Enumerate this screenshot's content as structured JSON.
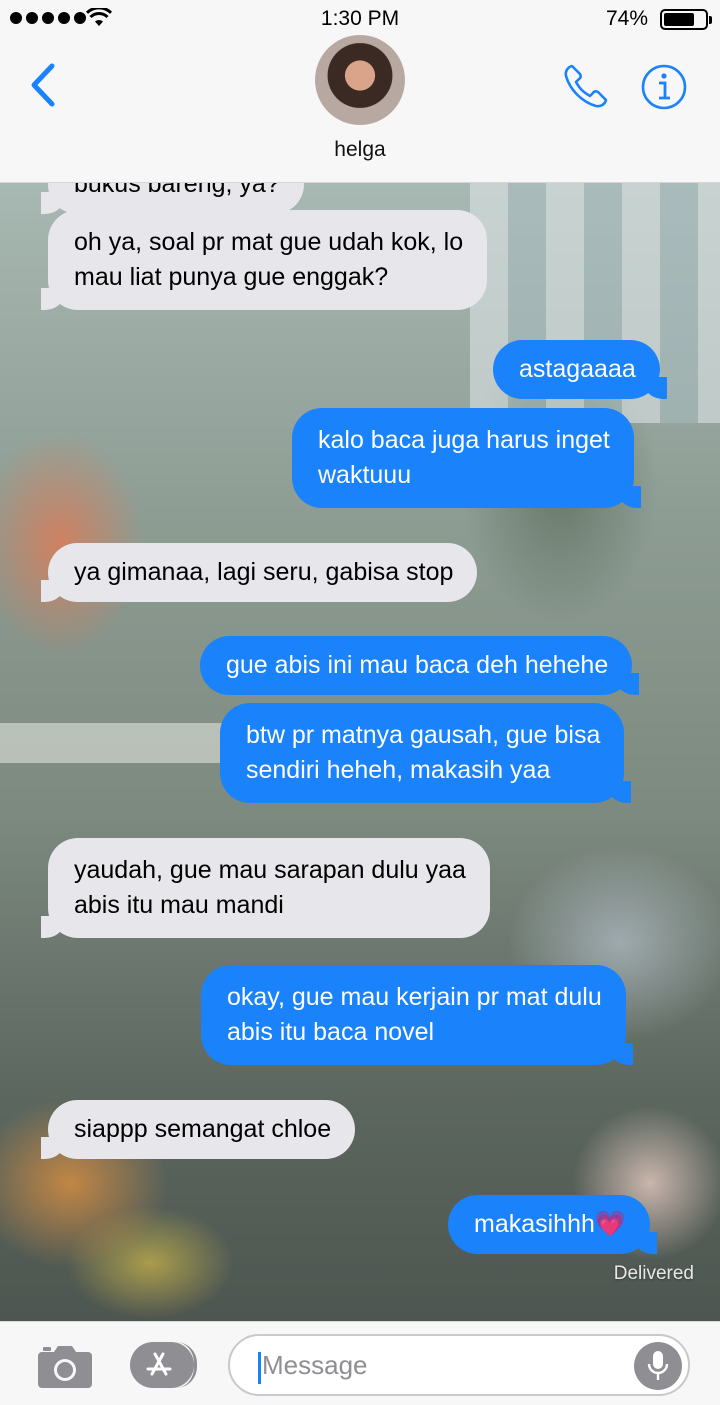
{
  "status_bar": {
    "time": "1:30 PM",
    "battery": "74%"
  },
  "header": {
    "contact_name": "helga"
  },
  "messages": [
    {
      "dir": "in",
      "lines": [
        "bukus bareng, ya?"
      ]
    },
    {
      "dir": "in",
      "lines": [
        "oh ya, soal pr mat gue udah kok, lo",
        "mau liat punya gue enggak?"
      ]
    },
    {
      "dir": "out",
      "lines": [
        "astagaaaa"
      ]
    },
    {
      "dir": "out",
      "lines": [
        "kalo baca juga harus inget",
        "waktuuu"
      ]
    },
    {
      "dir": "in",
      "lines": [
        "ya gimanaa, lagi seru, gabisa stop"
      ]
    },
    {
      "dir": "out",
      "lines": [
        "gue abis ini mau baca deh hehehe"
      ]
    },
    {
      "dir": "out",
      "lines": [
        "btw pr matnya gausah, gue bisa",
        "sendiri heheh, makasih yaa"
      ]
    },
    {
      "dir": "in",
      "lines": [
        "yaudah, gue mau sarapan dulu yaa",
        "abis itu mau mandi"
      ]
    },
    {
      "dir": "out",
      "lines": [
        "okay, gue mau kerjain pr mat dulu",
        "abis itu baca novel"
      ]
    },
    {
      "dir": "in",
      "lines": [
        "siappp semangat chloe"
      ]
    },
    {
      "dir": "out",
      "lines": [
        "makasihhh💗"
      ]
    }
  ],
  "delivered_label": "Delivered",
  "input": {
    "placeholder": "Message"
  },
  "colors": {
    "outgoing": "#1a82fb",
    "incoming": "#e6e6eb",
    "accent": "#1a82fb"
  }
}
